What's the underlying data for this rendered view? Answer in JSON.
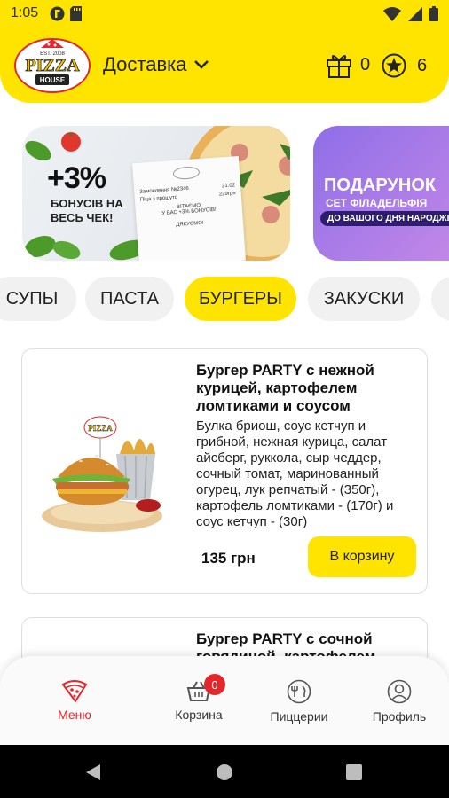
{
  "status_bar": {
    "time": "1:05"
  },
  "header": {
    "logo_text": "PIZZA HOUSE",
    "logo_est": "EST. 2008",
    "delivery_label": "Доставка",
    "gift_count": "0",
    "stars_count": "6",
    "accent_color": "#ffe400"
  },
  "banners": [
    {
      "big": "+3%",
      "sub": "БОНУСІВ НА ВЕСЬ ЧЕК!",
      "receipt": [
        "Замовлення №2346",
        "21.02",
        "Піца з прошуто",
        "229грн",
        "ВІТАЄМО",
        "У ВАС +3% БОНУСІВ!",
        "ДЯКУЄМО!"
      ]
    },
    {
      "line1": "ПОДАРУНОК",
      "line2": "СЕТ ФІЛАДЕЛЬФІЯ",
      "line3": "ДО ВАШОГО ДНЯ НАРОДЖЕННЯ"
    }
  ],
  "categories": [
    "СУПЫ",
    "ПАСТА",
    "БУРГЕРЫ",
    "ЗАКУСКИ"
  ],
  "active_category": "БУРГЕРЫ",
  "products": [
    {
      "title": "Бургер PARTY с нежной курицей, картофелем ломтиками и соусом",
      "desc": "Булка бриош, соус кетчуп и грибной, нежная курица, салат айсберг, руккола, сыр чеддер, сочный томат, маринованный огурец, лук репчатый - (350г), картофель ломтиками - (170г) и соус кетчуп - (30г)",
      "price": "135 грн",
      "button": "В корзину"
    },
    {
      "title": "Бургер PARTY с сочной говядиной, картофелем"
    }
  ],
  "bottom_nav": {
    "items": [
      {
        "label": "Меню",
        "icon": "pizza-slice-icon"
      },
      {
        "label": "Корзина",
        "icon": "basket-icon"
      },
      {
        "label": "Пиццерии",
        "icon": "pizzeria-icon"
      },
      {
        "label": "Профиль",
        "icon": "profile-icon"
      }
    ],
    "cart_badge": "0",
    "active_color": "#e5262b"
  }
}
